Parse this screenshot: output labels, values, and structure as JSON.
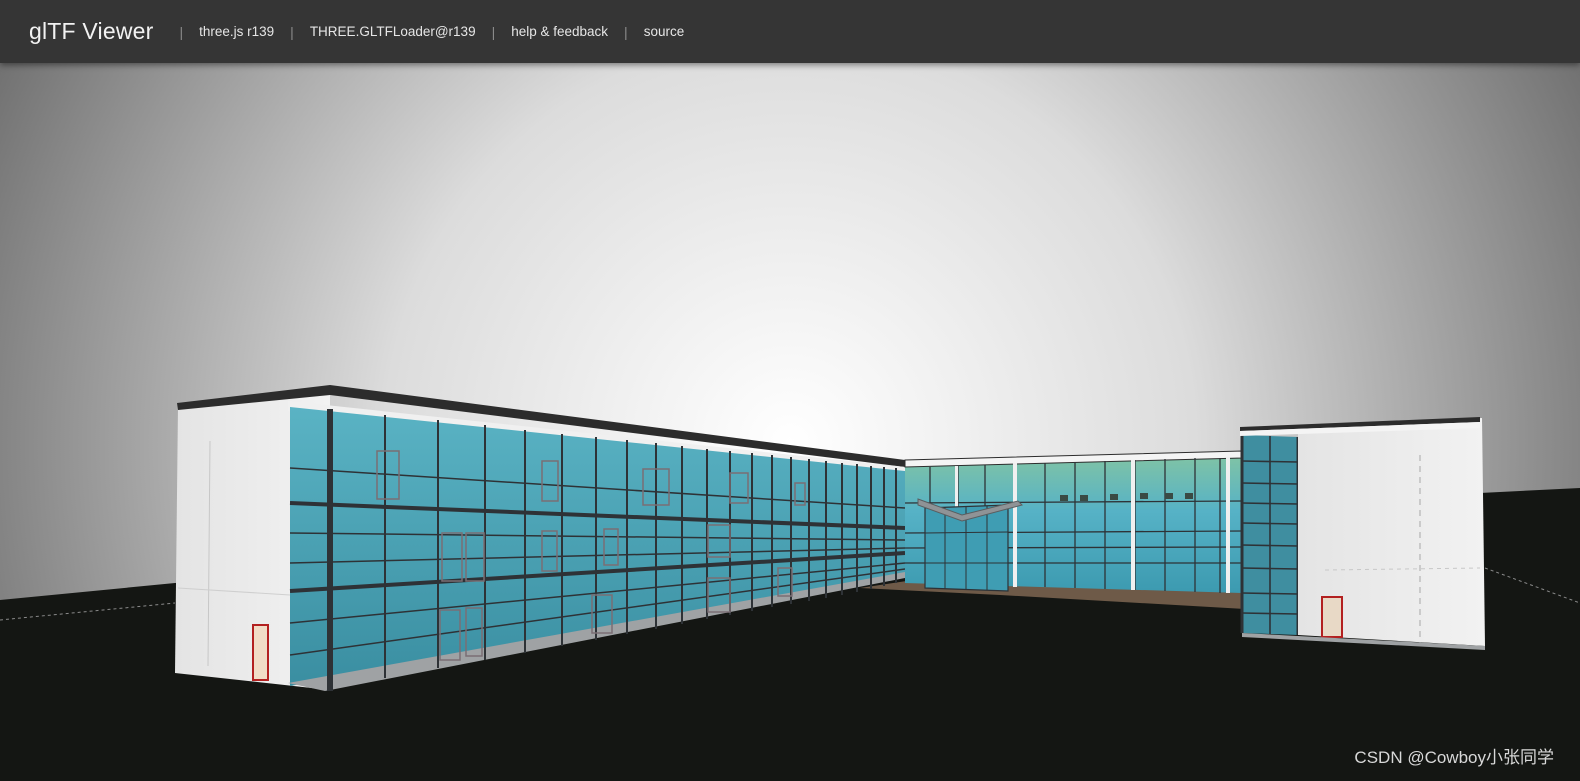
{
  "header": {
    "title": "glTF Viewer",
    "nav": [
      {
        "label": "three.js r139"
      },
      {
        "label": "THREE.GLTFLoader@r139"
      },
      {
        "label": "help & feedback"
      },
      {
        "label": "source"
      }
    ],
    "separator": "|"
  },
  "watermark": {
    "text": "CSDN @Cowboy小张同学"
  },
  "colors": {
    "header_bg": "#353535",
    "ground": "#141613",
    "glass": "#4b9fb0",
    "mullion": "#2e3236",
    "wall": "#e6e6e6",
    "door": "#b32020"
  }
}
